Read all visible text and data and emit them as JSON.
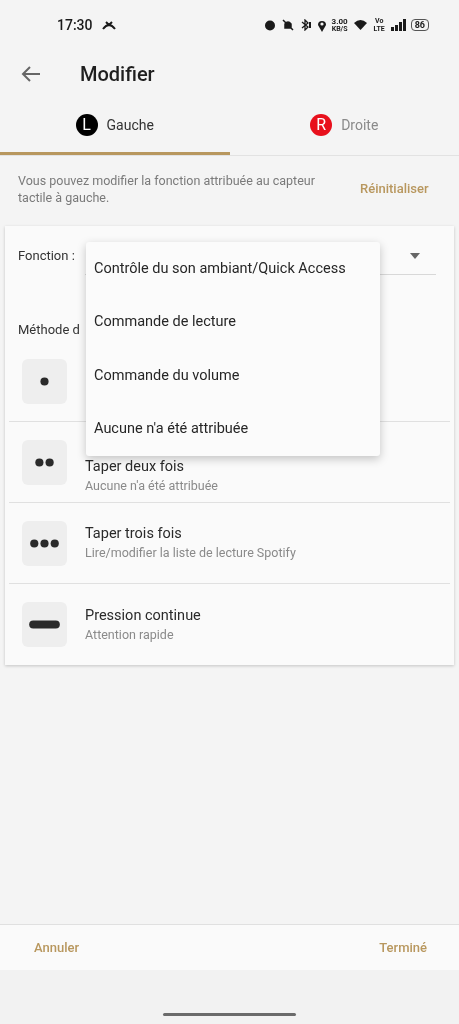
{
  "status_bar": {
    "time": "17:30",
    "speed_value": "3.00",
    "speed_unit": "KB/S",
    "network": "Vo LTE",
    "battery": "86"
  },
  "header": {
    "title": "Modifier"
  },
  "tabs": [
    {
      "badge": "L",
      "color": "#000000",
      "label": "Gauche",
      "selected": true
    },
    {
      "badge": "R",
      "color": "#e8101c",
      "label": "Droite",
      "selected": false
    }
  ],
  "description": "Vous pouvez modifier la fonction attribuée au capteur tactile à gauche.",
  "reset_link": "Réinitialiser",
  "function_field": {
    "label": "Fonction :"
  },
  "method_label": "Méthode d",
  "methods": [
    {
      "kind": "single"
    },
    {
      "kind": "double",
      "title": "Taper deux fois",
      "subtitle": "Aucune n'a été attribuée"
    },
    {
      "kind": "triple",
      "title": "Taper trois fois",
      "subtitle": "Lire/modifier la liste de lecture Spotify"
    },
    {
      "kind": "hold",
      "title": "Pression continue",
      "subtitle": "Attention rapide"
    }
  ],
  "dropdown_menu": [
    "Contrôle du son ambiant/Quick Access",
    "Commande de lecture",
    "Commande du volume",
    "Aucune n'a été attribuée"
  ],
  "footer": {
    "cancel": "Annuler",
    "done": "Terminé"
  }
}
